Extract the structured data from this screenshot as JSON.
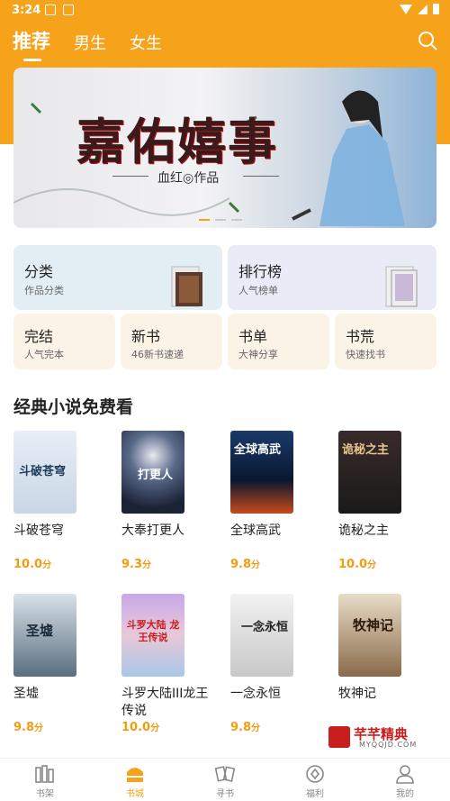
{
  "status_bar": {
    "time": "3:24"
  },
  "top_tabs": [
    {
      "label": "推荐",
      "active": true
    },
    {
      "label": "男生",
      "active": false
    },
    {
      "label": "女生",
      "active": false
    }
  ],
  "banner": {
    "title": "嘉佑嬉事",
    "subtitle": "血红◎作品",
    "slides": 3,
    "active_slide": 0
  },
  "categories": [
    {
      "title": "分类",
      "subtitle": "作品分类"
    },
    {
      "title": "排行榜",
      "subtitle": "人气榜单"
    },
    {
      "title": "完结",
      "subtitle": "人气完本"
    },
    {
      "title": "新书",
      "subtitle": "46新书速递"
    },
    {
      "title": "书单",
      "subtitle": "大神分享"
    },
    {
      "title": "书荒",
      "subtitle": "快速找书"
    }
  ],
  "section": {
    "title": "经典小说免费看"
  },
  "books": [
    {
      "name": "斗破苍穹",
      "score": "10.0",
      "unit": "分",
      "cover_text": "斗破苍穹"
    },
    {
      "name": "大奉打更人",
      "score": "9.3",
      "unit": "分",
      "cover_text": "打更人"
    },
    {
      "name": "全球高武",
      "score": "9.8",
      "unit": "分",
      "cover_text": "全球高武"
    },
    {
      "name": "诡秘之主",
      "score": "10.0",
      "unit": "分",
      "cover_text": "诡秘之主"
    },
    {
      "name": "圣墟",
      "score": "9.8",
      "unit": "分",
      "cover_text": "圣墟"
    },
    {
      "name": "斗罗大陆III龙王传说",
      "score": "10.0",
      "unit": "分",
      "cover_text": "斗罗大陆 龙王传说"
    },
    {
      "name": "一念永恒",
      "score": "9.8",
      "unit": "分",
      "cover_text": "一念永恒"
    },
    {
      "name": "牧神记",
      "score": "",
      "unit": "",
      "cover_text": "牧神记"
    }
  ],
  "watermark": {
    "text": "芊芊精典",
    "url": "MYQQJD.COM"
  },
  "bottom_nav": [
    {
      "label": "书架",
      "icon": "bookshelf-icon",
      "active": false
    },
    {
      "label": "书城",
      "icon": "bookstore-icon",
      "active": true
    },
    {
      "label": "寻书",
      "icon": "find-book-icon",
      "active": false
    },
    {
      "label": "福利",
      "icon": "welfare-icon",
      "active": false
    },
    {
      "label": "我的",
      "icon": "profile-icon",
      "active": false
    }
  ],
  "colors": {
    "accent": "#f7a21b",
    "score": "#f39c12"
  }
}
